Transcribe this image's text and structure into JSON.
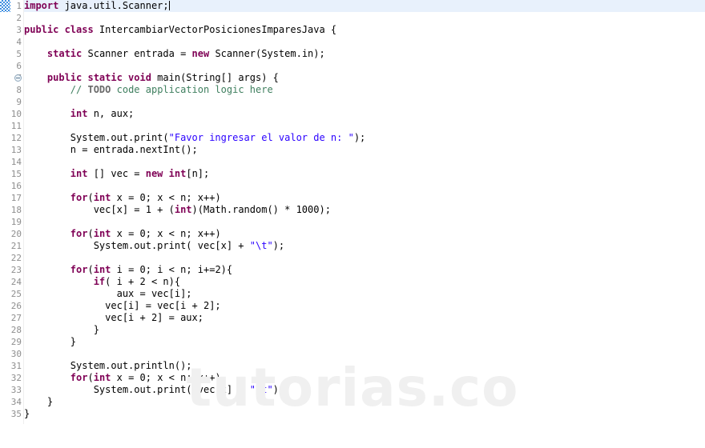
{
  "editor": {
    "language": "java",
    "watermark_text": "tutorias.co",
    "caret_line": 1,
    "folded_line": 7,
    "annotation_line": 1,
    "colors": {
      "background": "#ffffff",
      "current_line_highlight": "#e8f1fc",
      "gutter_text": "#8e8e8e",
      "keyword": "#7f0055",
      "string": "#2a00ff",
      "comment": "#3f7f5f",
      "todo": "#6a6a6a",
      "plain_text": "#000000",
      "annotation_glyph": "#3f8fe0",
      "watermark": "#f0f0f0"
    },
    "line_numbers": [
      "1",
      "2",
      "3",
      "4",
      "5",
      "6",
      "7",
      "8",
      "9",
      "10",
      "11",
      "12",
      "13",
      "14",
      "15",
      "16",
      "17",
      "18",
      "19",
      "20",
      "21",
      "22",
      "23",
      "24",
      "25",
      "26",
      "27",
      "28",
      "29",
      "30",
      "31",
      "32",
      "33",
      "34",
      "35"
    ],
    "lines": [
      {
        "n": "1",
        "tokens": [
          {
            "t": "kw",
            "v": "import"
          },
          {
            "t": "plain",
            "v": " java.util.Scanner;"
          }
        ],
        "caret": true
      },
      {
        "n": "2",
        "tokens": []
      },
      {
        "n": "3",
        "tokens": [
          {
            "t": "kw",
            "v": "public class"
          },
          {
            "t": "plain",
            "v": " IntercambiarVectorPosicionesImparesJava {"
          }
        ]
      },
      {
        "n": "4",
        "tokens": []
      },
      {
        "n": "5",
        "tokens": [
          {
            "t": "plain",
            "v": "    "
          },
          {
            "t": "kw",
            "v": "static"
          },
          {
            "t": "plain",
            "v": " Scanner entrada = "
          },
          {
            "t": "kw",
            "v": "new"
          },
          {
            "t": "plain",
            "v": " Scanner(System.in);"
          }
        ]
      },
      {
        "n": "6",
        "tokens": []
      },
      {
        "n": "7",
        "tokens": [
          {
            "t": "plain",
            "v": "    "
          },
          {
            "t": "kw",
            "v": "public static void"
          },
          {
            "t": "plain",
            "v": " main(String[] args) {"
          }
        ],
        "fold": true
      },
      {
        "n": "8",
        "tokens": [
          {
            "t": "plain",
            "v": "        "
          },
          {
            "t": "cmt",
            "v": "// "
          },
          {
            "t": "todo",
            "v": "TODO"
          },
          {
            "t": "cmt",
            "v": " code application logic here"
          }
        ]
      },
      {
        "n": "9",
        "tokens": []
      },
      {
        "n": "10",
        "tokens": [
          {
            "t": "plain",
            "v": "        "
          },
          {
            "t": "kw",
            "v": "int"
          },
          {
            "t": "plain",
            "v": " n, aux;"
          }
        ]
      },
      {
        "n": "11",
        "tokens": []
      },
      {
        "n": "12",
        "tokens": [
          {
            "t": "plain",
            "v": "        System.out.print("
          },
          {
            "t": "str",
            "v": "\"Favor ingresar el valor de n: \""
          },
          {
            "t": "plain",
            "v": ");"
          }
        ]
      },
      {
        "n": "13",
        "tokens": [
          {
            "t": "plain",
            "v": "        n = entrada.nextInt();"
          }
        ]
      },
      {
        "n": "14",
        "tokens": []
      },
      {
        "n": "15",
        "tokens": [
          {
            "t": "plain",
            "v": "        "
          },
          {
            "t": "kw",
            "v": "int"
          },
          {
            "t": "plain",
            "v": " [] vec = "
          },
          {
            "t": "kw",
            "v": "new"
          },
          {
            "t": "plain",
            "v": " "
          },
          {
            "t": "kw",
            "v": "int"
          },
          {
            "t": "plain",
            "v": "[n];"
          }
        ]
      },
      {
        "n": "16",
        "tokens": []
      },
      {
        "n": "17",
        "tokens": [
          {
            "t": "plain",
            "v": "        "
          },
          {
            "t": "kw",
            "v": "for"
          },
          {
            "t": "plain",
            "v": "("
          },
          {
            "t": "kw",
            "v": "int"
          },
          {
            "t": "plain",
            "v": " x = 0; x < n; x++)"
          }
        ]
      },
      {
        "n": "18",
        "tokens": [
          {
            "t": "plain",
            "v": "            vec[x] = 1 + ("
          },
          {
            "t": "kw",
            "v": "int"
          },
          {
            "t": "plain",
            "v": ")(Math.random() * 1000);"
          }
        ]
      },
      {
        "n": "19",
        "tokens": []
      },
      {
        "n": "20",
        "tokens": [
          {
            "t": "plain",
            "v": "        "
          },
          {
            "t": "kw",
            "v": "for"
          },
          {
            "t": "plain",
            "v": "("
          },
          {
            "t": "kw",
            "v": "int"
          },
          {
            "t": "plain",
            "v": " x = 0; x < n; x++)"
          }
        ]
      },
      {
        "n": "21",
        "tokens": [
          {
            "t": "plain",
            "v": "            System.out.print( vec[x] + "
          },
          {
            "t": "str",
            "v": "\"\\t\""
          },
          {
            "t": "plain",
            "v": ");"
          }
        ]
      },
      {
        "n": "22",
        "tokens": []
      },
      {
        "n": "23",
        "tokens": [
          {
            "t": "plain",
            "v": "        "
          },
          {
            "t": "kw",
            "v": "for"
          },
          {
            "t": "plain",
            "v": "("
          },
          {
            "t": "kw",
            "v": "int"
          },
          {
            "t": "plain",
            "v": " i = 0; i < n; i+=2){"
          }
        ]
      },
      {
        "n": "24",
        "tokens": [
          {
            "t": "plain",
            "v": "            "
          },
          {
            "t": "kw",
            "v": "if"
          },
          {
            "t": "plain",
            "v": "( i + 2 < n){"
          }
        ]
      },
      {
        "n": "25",
        "tokens": [
          {
            "t": "plain",
            "v": "                aux = vec[i];"
          }
        ]
      },
      {
        "n": "26",
        "tokens": [
          {
            "t": "plain",
            "v": "              vec[i] = vec[i + 2];"
          }
        ]
      },
      {
        "n": "27",
        "tokens": [
          {
            "t": "plain",
            "v": "              vec[i + 2] = aux;"
          }
        ]
      },
      {
        "n": "28",
        "tokens": [
          {
            "t": "plain",
            "v": "            }"
          }
        ]
      },
      {
        "n": "29",
        "tokens": [
          {
            "t": "plain",
            "v": "        }"
          }
        ]
      },
      {
        "n": "30",
        "tokens": []
      },
      {
        "n": "31",
        "tokens": [
          {
            "t": "plain",
            "v": "        System.out.println();"
          }
        ]
      },
      {
        "n": "32",
        "tokens": [
          {
            "t": "plain",
            "v": "        "
          },
          {
            "t": "kw",
            "v": "for"
          },
          {
            "t": "plain",
            "v": "("
          },
          {
            "t": "kw",
            "v": "int"
          },
          {
            "t": "plain",
            "v": " x = 0; x < n; x++)"
          }
        ]
      },
      {
        "n": "33",
        "tokens": [
          {
            "t": "plain",
            "v": "            System.out.print( vec[x] + "
          },
          {
            "t": "str",
            "v": "\"\\t\""
          },
          {
            "t": "plain",
            "v": ");"
          }
        ]
      },
      {
        "n": "34",
        "tokens": [
          {
            "t": "plain",
            "v": "    }"
          }
        ]
      },
      {
        "n": "35",
        "tokens": [
          {
            "t": "plain",
            "v": "}"
          }
        ]
      }
    ]
  }
}
